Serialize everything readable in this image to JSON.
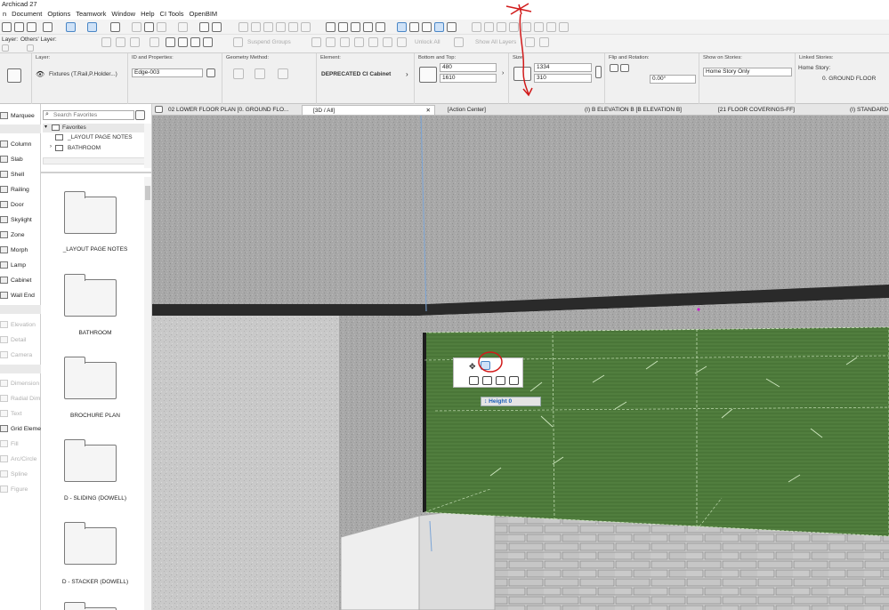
{
  "app": {
    "title": "Archicad 27"
  },
  "menu": [
    "n",
    "Document",
    "Options",
    "Teamwork",
    "Window",
    "Help",
    "CI Tools",
    "OpenBIM"
  ],
  "toolbar2": {
    "layer_label": "Layer:",
    "others_label": "Others' Layer:",
    "suspend_groups": "Suspend Groups",
    "unlock_all": "Unlock All",
    "show_all_layers": "Show All Layers"
  },
  "info": {
    "layer": {
      "header": "Layer:",
      "value": "Fixtures (T.Rail,P.Holder...)"
    },
    "id": {
      "header": "ID and Properties:",
      "value": "Edge-003"
    },
    "geometry": {
      "header": "Geometry Method:"
    },
    "element": {
      "header": "Element:",
      "value": "DEPRECATED CI Cabinet"
    },
    "bottom_top": {
      "header": "Bottom and Top:",
      "bottom": "480",
      "top": "1610"
    },
    "size": {
      "header": "Size:",
      "width": "1334",
      "depth": "310"
    },
    "flip": {
      "header": "Flip and Rotation:",
      "angle": "0.00°"
    },
    "stories": {
      "header": "Show on Stories:",
      "value": "Home Story Only"
    },
    "linked": {
      "header": "Linked Stories:",
      "home_label": "Home Story:",
      "home_value": "0. GROUND FLOOR"
    }
  },
  "tabs": [
    {
      "label": "02 LOWER FLOOR PLAN [0. GROUND FLO..."
    },
    {
      "label": "[3D / All]",
      "active": true
    },
    {
      "label": "[Action Center]"
    },
    {
      "label": "(I) B ELEVATION B [B ELEVATION B]"
    },
    {
      "label": "[21 FLOOR COVERINGS-FF]"
    },
    {
      "label": "(I) STANDARD"
    }
  ],
  "tools": {
    "marquee": "Marquee",
    "active": [
      "Column",
      "Slab",
      "Shell",
      "Railing",
      "Door",
      "Skylight",
      "Zone",
      "Morph",
      "Lamp",
      "Cabinet",
      "Wall End"
    ],
    "view": [
      "Elevation",
      "Detail",
      "Camera"
    ],
    "document": [
      "Dimension",
      "Radial Dim",
      "Text",
      "Grid Eleme",
      "Fill",
      "Arc/Circle",
      "Spline",
      "Figure"
    ]
  },
  "browser": {
    "search_placeholder": "Search Favorites",
    "root": "Favorites",
    "tree": [
      "_LAYOUT PAGE NOTES",
      "BATHROOM"
    ],
    "folders": [
      "_LAYOUT PAGE NOTES",
      "BATHROOM",
      "BROCHURE PLAN",
      "D - SLIDING (DOWELL)",
      "D - STACKER (DOWELL)"
    ]
  },
  "viewport": {
    "height_label": "Height",
    "height_value": "0"
  },
  "colors": {
    "cabinet_fill": "#4d7a3a",
    "annotation": "#d11a1a",
    "selection_blue": "#1c5fb6"
  }
}
